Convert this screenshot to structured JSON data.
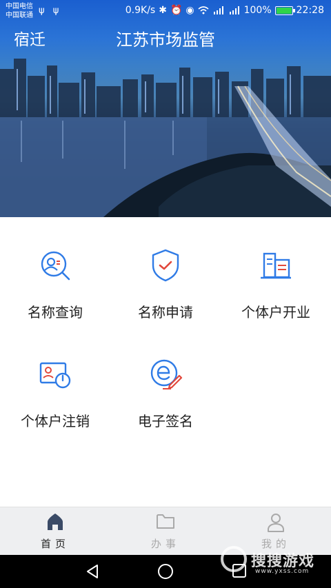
{
  "status": {
    "carrier1": "中国电信",
    "carrier2": "中国联通",
    "usb": "ψ ψ",
    "speed": "0.9K/s",
    "battery": "100%",
    "time": "22:28"
  },
  "header": {
    "city": "宿迁",
    "title": "江苏市场监管"
  },
  "services": [
    {
      "label": "名称查询",
      "icon": "name-search-icon"
    },
    {
      "label": "名称申请",
      "icon": "shield-check-icon"
    },
    {
      "label": "个体户开业",
      "icon": "building-icon"
    },
    {
      "label": "个体户注销",
      "icon": "id-card-power-icon"
    },
    {
      "label": "电子签名",
      "icon": "e-signature-icon"
    }
  ],
  "bottom_nav": [
    {
      "label": "首页",
      "icon": "home-icon",
      "active": true
    },
    {
      "label": "办事",
      "icon": "folder-icon",
      "active": false
    },
    {
      "label": "我的",
      "icon": "user-icon",
      "active": false
    }
  ],
  "watermark": {
    "title": "搜搜游戏",
    "url": "www.yxss.com"
  },
  "colors": {
    "accent": "#2f7be6",
    "icon_red": "#e2483c",
    "nav_active": "#3a4a66"
  }
}
